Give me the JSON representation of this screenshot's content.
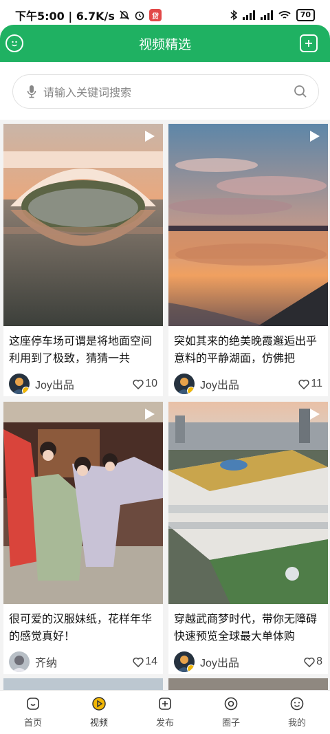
{
  "status_bar": {
    "time_speed": "下午5:00 | 6.7K/s",
    "app_badge": "贷",
    "battery": "70"
  },
  "header": {
    "title": "视频精选"
  },
  "search": {
    "placeholder": "请输入关键词搜索"
  },
  "cards": [
    {
      "title": "这座停车场可谓是将地面空间利用到了极致，猜猜一共",
      "author": "Joy出品",
      "likes": "10"
    },
    {
      "title": "突如其来的绝美晚霞邂逅出乎意料的平静湖面，仿佛把",
      "author": "Joy出品",
      "likes": "11"
    },
    {
      "title": "很可爱的汉服妹纸，花样年华的感觉真好！",
      "author": "齐纳",
      "likes": "14"
    },
    {
      "title": "穿越武商梦时代，带你无障碍快速预览全球最大单体购",
      "author": "Joy出品",
      "likes": "8"
    }
  ],
  "tabbar": {
    "items": [
      {
        "label": "首页",
        "icon": "home-icon"
      },
      {
        "label": "视频",
        "icon": "video-play-icon"
      },
      {
        "label": "发布",
        "icon": "add-icon"
      },
      {
        "label": "圈子",
        "icon": "circle-icon"
      },
      {
        "label": "我的",
        "icon": "profile-icon"
      }
    ],
    "active": "视频"
  },
  "colors": {
    "brand_green": "#1fb162",
    "active_tab": "#f2b705"
  }
}
